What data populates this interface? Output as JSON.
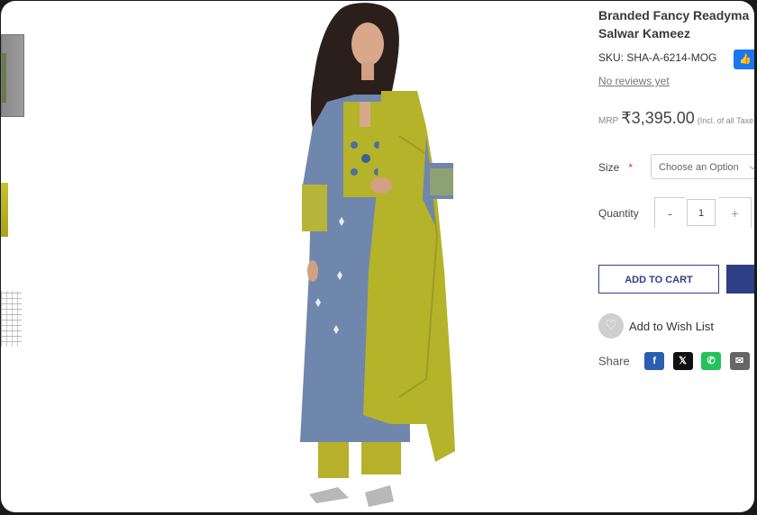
{
  "product": {
    "title_line1": "Branded Fancy Readyma",
    "title_line2": "Salwar Kameez",
    "sku": "SKU: SHA-A-6214-MOG",
    "reviews_link": "No reviews yet",
    "mrp_label": "MRP",
    "price": "₹3,395.00",
    "tax_note": "(Incl. of all Taxe"
  },
  "options": {
    "size_label": "Size",
    "required_mark": "*",
    "size_placeholder": "Choose an Option",
    "quantity_label": "Quantity",
    "quantity_value": "1",
    "minus": "-",
    "plus": "+"
  },
  "actions": {
    "add_to_cart": "ADD TO CART",
    "wishlist": "Add to Wish List",
    "share_label": "Share"
  },
  "social": {
    "facebook": "f",
    "x": "𝕏",
    "whatsapp": "✆",
    "mail": "✉",
    "like": "👍"
  },
  "colors": {
    "accent": "#2e3f86",
    "kurta_blue": "#6f86ad",
    "dupatta_yellow": "#b4b32a"
  }
}
